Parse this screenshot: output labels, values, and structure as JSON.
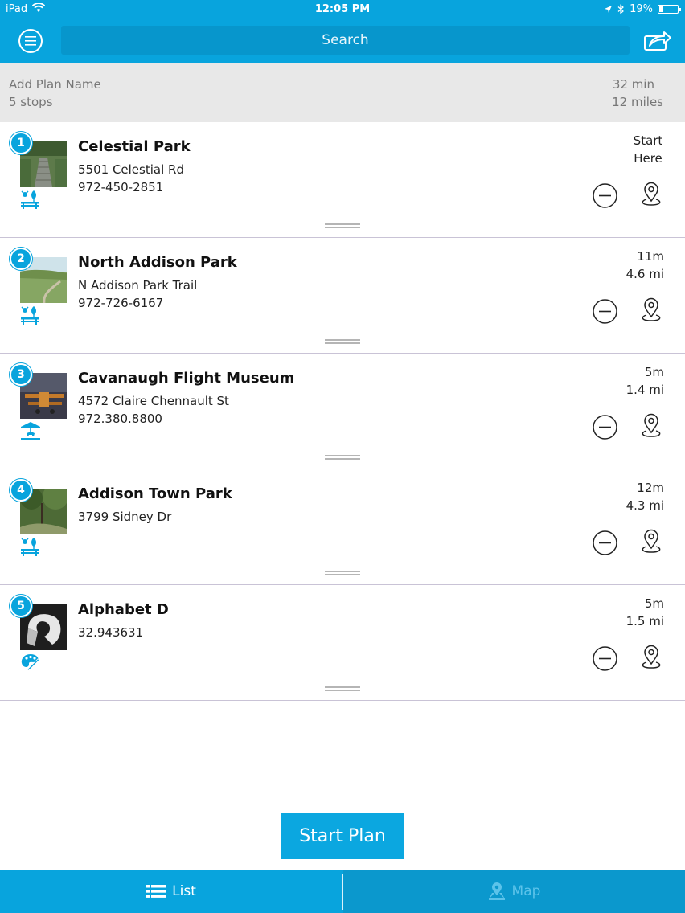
{
  "status_bar": {
    "carrier": "iPad",
    "time": "12:05 PM",
    "battery": "19%"
  },
  "nav": {
    "search_placeholder": "Search"
  },
  "plan": {
    "name_placeholder": "Add Plan Name",
    "stops": "5 stops",
    "duration": "32 min",
    "distance": "12 miles"
  },
  "stops": [
    {
      "number": "1",
      "name": "Celestial Park",
      "address": "5501 Celestial Rd",
      "phone": "972-450-2851",
      "time": "Start",
      "distance": "Here",
      "category_icon": "park-bench-icon"
    },
    {
      "number": "2",
      "name": "North Addison Park",
      "address": "N Addison Park Trail",
      "phone": "972-726-6167",
      "time": "11m",
      "distance": "4.6 mi",
      "category_icon": "park-bench-icon"
    },
    {
      "number": "3",
      "name": "Cavanaugh Flight Museum",
      "address": "4572 Claire Chennault St",
      "phone": "972.380.8800",
      "time": "5m",
      "distance": "1.4 mi",
      "category_icon": "carousel-icon"
    },
    {
      "number": "4",
      "name": "Addison Town Park",
      "address": "3799 Sidney Dr",
      "phone": "",
      "time": "12m",
      "distance": "4.3 mi",
      "category_icon": "park-bench-icon"
    },
    {
      "number": "5",
      "name": "Alphabet D",
      "address": "32.943631",
      "phone": "",
      "time": "5m",
      "distance": "1.5 mi",
      "category_icon": "art-palette-icon"
    }
  ],
  "actions": {
    "start_plan": "Start Plan"
  },
  "tabs": {
    "list": "List",
    "map": "Map"
  },
  "colors": {
    "accent": "#08a4dd",
    "header_bg": "#e8e8e8",
    "divider": "#c9c3d6"
  }
}
